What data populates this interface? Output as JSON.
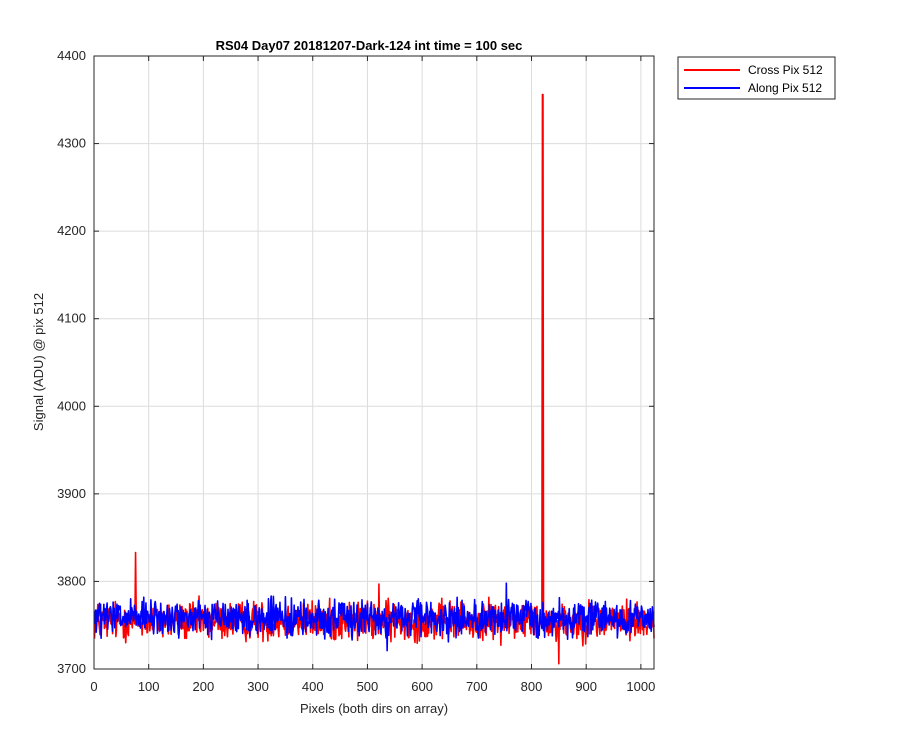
{
  "chart_data": {
    "type": "line",
    "title": "RS04 Day07 20181207-Dark-124 int time = 100 sec",
    "xlabel": "Pixels (both dirs on array)",
    "ylabel": "Signal (ADU) @ pix 512",
    "xlim": [
      0,
      1024
    ],
    "ylim": [
      3700,
      4400
    ],
    "xticks": [
      0,
      100,
      200,
      300,
      400,
      500,
      600,
      700,
      800,
      900,
      1000
    ],
    "yticks": [
      3700,
      3800,
      3900,
      4000,
      4100,
      4200,
      4300,
      4400
    ],
    "grid": true,
    "legend_position": "outside-top-right",
    "series": [
      {
        "name": "Cross Pix 512",
        "color": "#ff0000",
        "baseline": 3755,
        "noise": 11,
        "spikes": [
          {
            "x": 75,
            "y": 3833
          },
          {
            "x": 819,
            "y": 4356
          },
          {
            "x": 820,
            "y": 4356
          },
          {
            "x": 849,
            "y": 3706
          },
          {
            "x": 520,
            "y": 3797
          }
        ]
      },
      {
        "name": "Along Pix 512",
        "color": "#0000ff",
        "baseline": 3758,
        "noise": 10,
        "spikes": [
          {
            "x": 753,
            "y": 3798
          },
          {
            "x": 535,
            "y": 3721
          }
        ]
      }
    ]
  }
}
